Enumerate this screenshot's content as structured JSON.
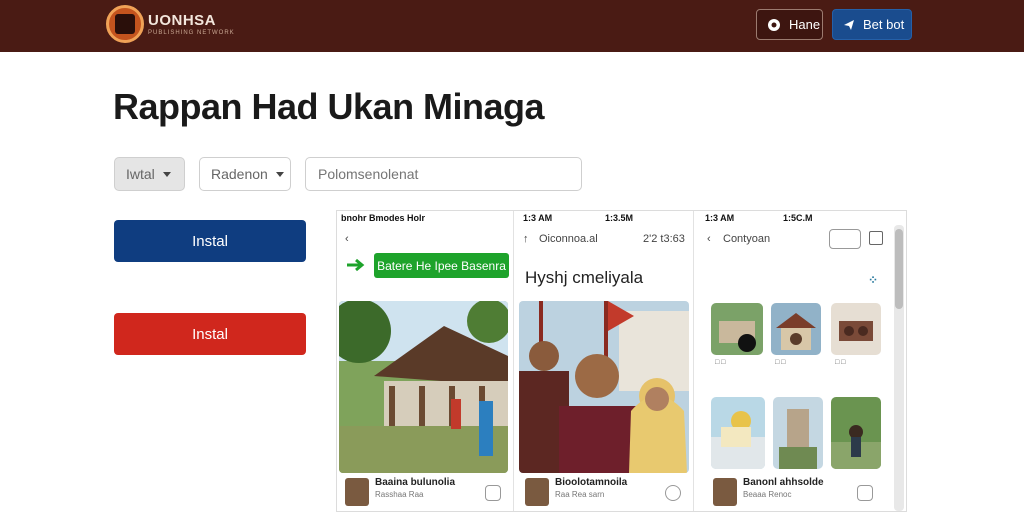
{
  "header": {
    "brand": "UONHSA",
    "brand_sub": "PUBLISHING NETWORK",
    "home_label": "Hane",
    "login_label": "Bet bot",
    "colors": {
      "bar": "#4a1b14",
      "login": "#1a4c8e"
    }
  },
  "page": {
    "title": "Rappan Had Ukan Minaga"
  },
  "controls": {
    "select_1": "Iwtal",
    "select_2": "Radenon",
    "search_placeholder": "Polomsenolenat"
  },
  "actions": {
    "primary_label": "Instal",
    "secondary_label": "Instal",
    "colors": {
      "primary": "#0f3d80",
      "secondary": "#d0271d"
    }
  },
  "preview": {
    "screen1": {
      "status_time": "bnohr Bmodes Holr",
      "nav_text": "",
      "banner": "Batere He Ipee Basenra",
      "card_name": "Baaina bulunolia",
      "card_sub": "Rasshaa Raa"
    },
    "screen2": {
      "status_time": "1:3 AM",
      "status_time_2": "1:3.5M",
      "nav_text": "Oiconnoa.al",
      "nav_count": "2'2 t3:63",
      "section_title": "Hyshj cmeliyala",
      "card_name": "Bioolotamnoila",
      "card_sub": "Raa Rea sarn"
    },
    "screen3": {
      "status_time": "1:3 AM",
      "status_time_2": "1:5C.M",
      "nav_text": "Contyoan",
      "card_name": "Banonl ahhsolde",
      "card_sub": "Beaaa Renoc"
    }
  }
}
